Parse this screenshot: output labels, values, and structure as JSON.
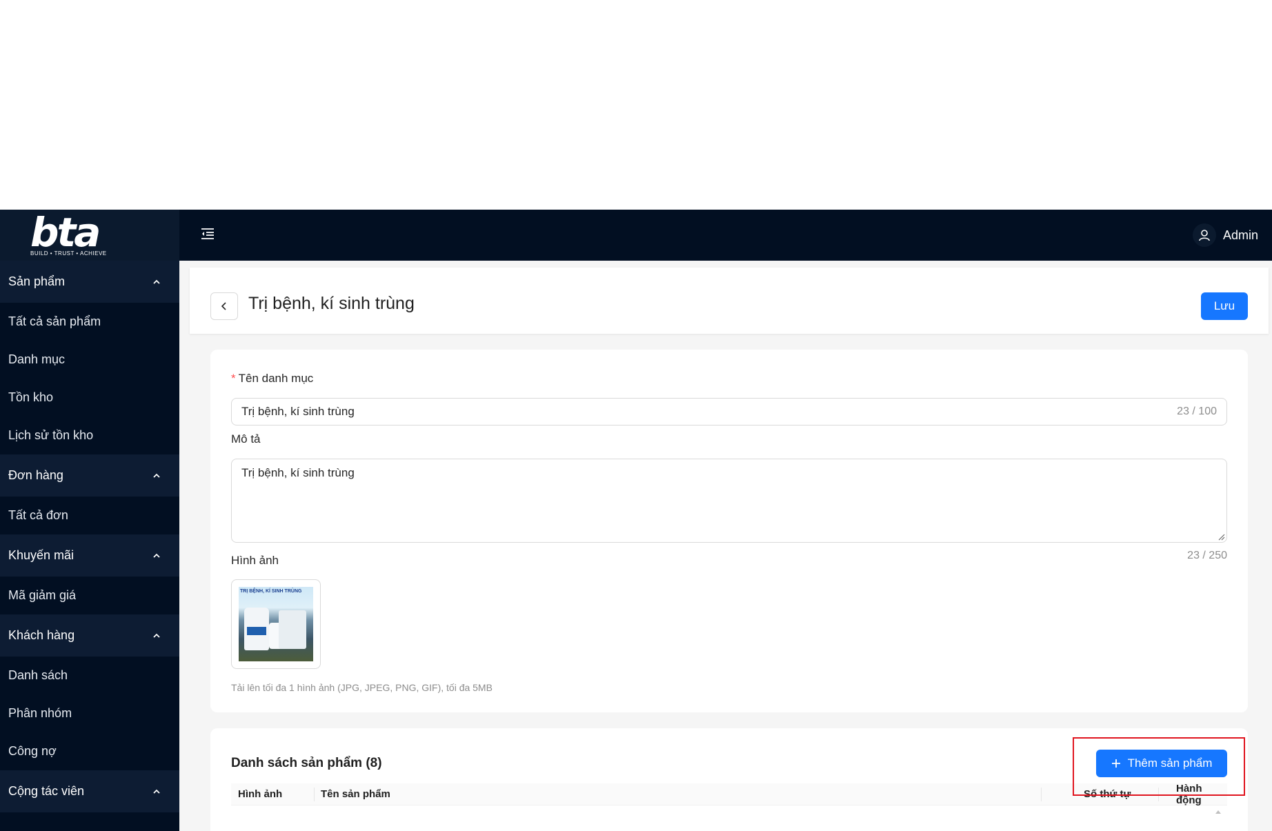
{
  "sidebar": {
    "logo_text": "bta",
    "logo_tagline": "BUILD • TRUST • ACHIEVE",
    "groups": [
      {
        "label": "Sản phẩm",
        "items": [
          "Tất cả sản phẩm",
          "Danh mục",
          "Tồn kho",
          "Lịch sử tồn kho"
        ]
      },
      {
        "label": "Đơn hàng",
        "items": [
          "Tất cả đơn"
        ]
      },
      {
        "label": "Khuyến mãi",
        "items": [
          "Mã giảm giá"
        ]
      },
      {
        "label": "Khách hàng",
        "items": [
          "Danh sách",
          "Phân nhóm",
          "Công nợ"
        ]
      },
      {
        "label": "Cộng tác viên",
        "items": []
      }
    ]
  },
  "header": {
    "user_name": "Admin"
  },
  "page": {
    "title": "Trị bệnh, kí sinh trùng",
    "save_label": "Lưu"
  },
  "form": {
    "name_label": "Tên danh mục",
    "name_value": "Trị bệnh, kí sinh trùng",
    "name_count": "23 / 100",
    "description_label": "Mô tả",
    "description_value": "Trị bệnh, kí sinh trùng",
    "description_count": "23 / 250",
    "image_label": "Hình ảnh",
    "image_caption": "TRỊ BỆNH, KÍ SINH TRÙNG",
    "upload_hint": "Tải lên tối đa 1 hình ảnh (JPG, JPEG, PNG, GIF), tối đa 5MB"
  },
  "product_list": {
    "title": "Danh sách sản phẩm (8)",
    "add_label": "Thêm sản phẩm",
    "columns": [
      "Hình ảnh",
      "Tên sản phẩm",
      "Số thứ tự",
      "Hành động"
    ]
  },
  "colors": {
    "sidebar_bg": "#020f22",
    "primary": "#1677ff",
    "highlight": "#e0141e"
  }
}
